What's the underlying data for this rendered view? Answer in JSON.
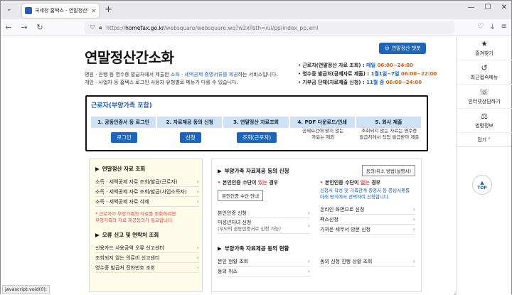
{
  "browser": {
    "tab_title": "국세청 홈택스 - 연말정산간소",
    "new_tab": "+",
    "url_prefix": "https://",
    "url_host": "hometax.go.kr",
    "url_path": "/websquare/websquare.wq?w2xPath=/ui/pp/index_pp.xml",
    "status": "javascript:void(0);"
  },
  "page": {
    "title": "연말정산간소화",
    "chat_button": "연말정산 챗봇",
    "desc_line1_a": "병원 · 은행 등 영수증 발급처에서 제출한 ",
    "desc_line1_hl": "소득 · 세액공제 증명서류를 제공",
    "desc_line1_b": "하는 서비스입니다.",
    "desc_line2": "개인 · 사업자 등 홈택스 로그인 사용자 유형별로 메뉴가 다를 수 있습니다.",
    "schedule": [
      {
        "key": "근로자(연말정산 자료 조회) : ",
        "v1": "매일 ",
        "v2": "06:00~24:00"
      },
      {
        "key": "영수증 발급처(공제자료 제출) : ",
        "v1": "1월1일~7일 ",
        "v2": "06:00~22:00"
      },
      {
        "key": "기부금 단체(자료제출 신청) : ",
        "v1": "11월 중 ",
        "v2": "06:00~24:00"
      }
    ]
  },
  "process": {
    "title": "근로자(부양가족 포함)",
    "steps": [
      {
        "label": "1. 공동인증서 등 로그인",
        "action": "로그인",
        "kind": "button"
      },
      {
        "label": "2. 자료제공 동의 신청",
        "action": "신청",
        "kind": "button"
      },
      {
        "label": "3. 연말정산 자료조회",
        "action": "조회(근로자)",
        "kind": "button"
      },
      {
        "label": "4. PDF 다운로드/인쇄",
        "action": "공제요건에 맞지 않는\n자료는 제외",
        "kind": "text"
      },
      {
        "label": "5. 회사 제출",
        "action": "조회되지 않는 자료는 영수증\n발급처에서 직접 발급받아 제출",
        "kind": "text"
      }
    ]
  },
  "left_panel": {
    "sec1_title": "연말정산 자료 조회",
    "sec1_items": [
      "소득 · 세액공제 자료 조회/발급(근로자)",
      "소득 · 세액공제 자료 조회/발급(사업소득자)",
      "소득 · 세액공제 자료 삭제"
    ],
    "note": "* 근로자가 부양가족의 자료를 조회하려면\n  부양가족의 자료 제공동의가 필요합니다.",
    "sec2_title": "오류 신고 및 연락처 조회",
    "sec2_items": [
      "신용카드 사용금액 오류 신고센터",
      "조회되지 않는 의료비 신고센터",
      "영수증 발급처 전화번호 조회"
    ]
  },
  "right_panel": {
    "sec1_title": "부양가족 자료제공 동의 신청",
    "method_button": "동의/취소 방법(설명서)",
    "col1_head_a": "본인인증 수단이 ",
    "col1_head_b": "있는",
    "col1_head_c": " 경우",
    "col1_btn": "본인인증 수단 안내",
    "col1_items": [
      {
        "label": "본인인증 신청",
        "sub": ""
      },
      {
        "label": "미성년자녀 신청",
        "sub": "(부모의 공동인증서로 신청 가능)"
      }
    ],
    "col2_head_a": "본인인증 수단이 ",
    "col2_head_b": "없는",
    "col2_head_c": " 경우",
    "col2_desc": "신청서 작성 및 가족관계 증명서 등 증빙서류를\n아래 방식에서 선택하여 신청합니다.",
    "col2_items": [
      "온라인 화면으로 신청",
      "팩스신청",
      "가까운 세무서 방문 신청"
    ],
    "sec2_title": "부양가족 자료제공 동의 현황",
    "sec2_col1": [
      "본인 현황 조회",
      "동의 취소"
    ],
    "sec2_col2": [
      "동의 신청 진행 상황 조회"
    ]
  },
  "sidebar": {
    "items": [
      {
        "icon": "★",
        "label": "즐겨찾기"
      },
      {
        "icon": "↺",
        "label": "최근접속메뉴"
      },
      {
        "icon": "☏",
        "label": "인터넷상담하기"
      },
      {
        "icon": "⚖",
        "label": "법령정보"
      }
    ],
    "fold": "접기 ˄",
    "top": "TOP"
  }
}
